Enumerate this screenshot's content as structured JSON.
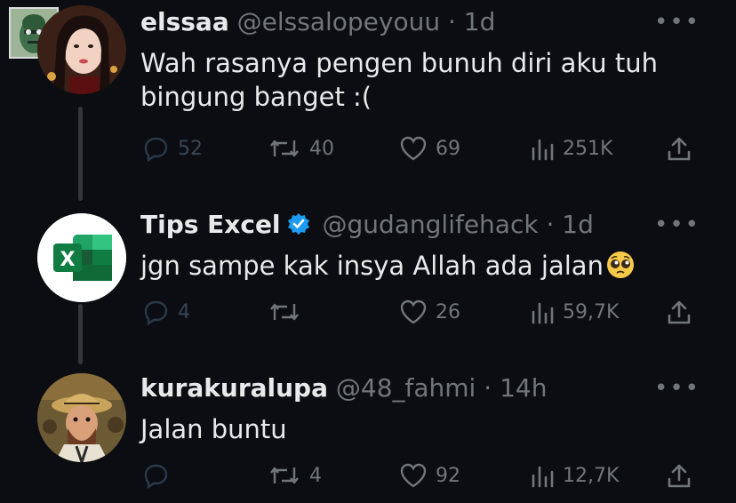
{
  "tweets": [
    {
      "name": "elssaa",
      "handle": "@elssalopeyouu",
      "sep": "·",
      "time": "1d",
      "text": "Wah rasanya pengen bunuh diri aku tuh bingung banget :(",
      "replies": "52",
      "retweets": "40",
      "likes": "69",
      "views": "251K"
    },
    {
      "name": "Tips Excel",
      "handle": "@gudanglifehack",
      "sep": "·",
      "time": "1d",
      "text": "jgn sampe kak insya Allah ada jalan",
      "replies": "4",
      "retweets": "",
      "likes": "26",
      "views": "59,7K",
      "logo_letter": "X"
    },
    {
      "name": "kurakuralupa",
      "handle": "@48_fahmi",
      "sep": "·",
      "time": "14h",
      "text": "Jalan buntu",
      "replies": "",
      "retweets": "4",
      "likes": "92",
      "views": "12,7K"
    }
  ],
  "more_label": "•••",
  "colors": {
    "background": "#0b0d12",
    "text": "#e7e9ea",
    "muted": "#71767b",
    "verified": "#1d9bf0",
    "thread_line": "#333639"
  },
  "icons": [
    "reply-icon",
    "retweet-icon",
    "like-icon",
    "views-icon",
    "share-icon",
    "verified-badge-icon",
    "pleading-face-emoji",
    "more-icon"
  ]
}
